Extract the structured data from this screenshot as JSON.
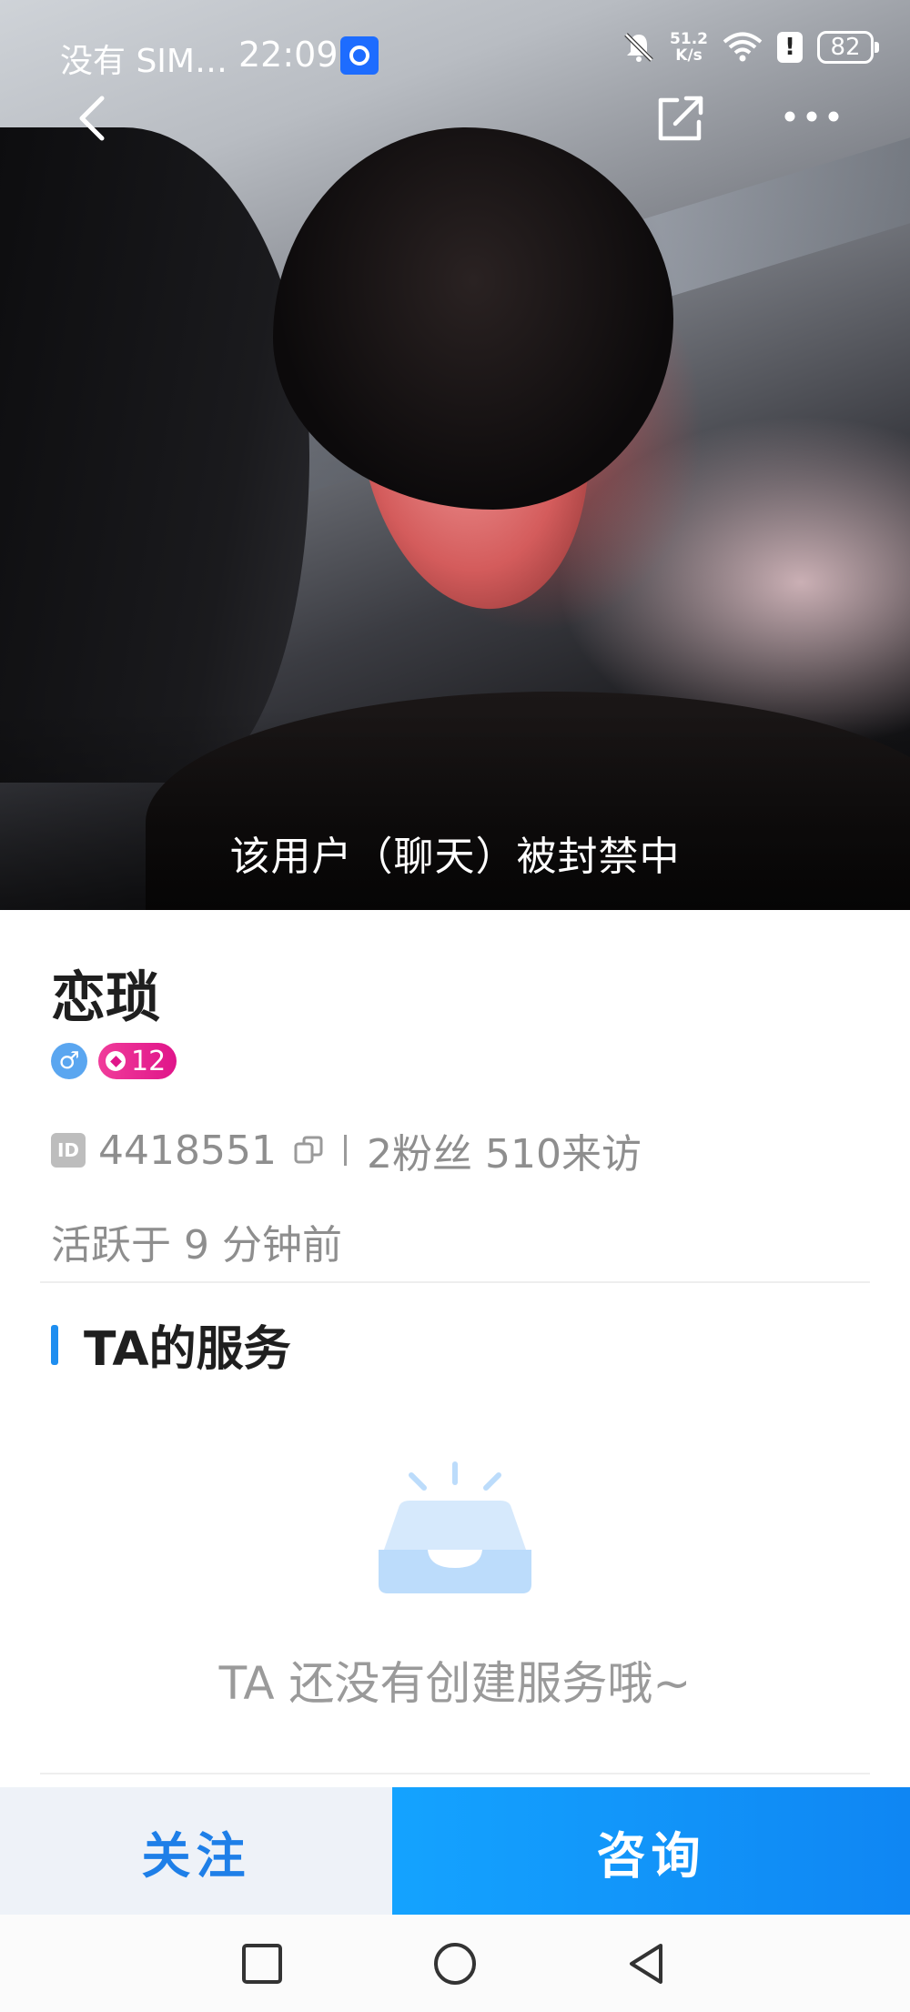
{
  "status_bar": {
    "carrier": "没有 SIM…",
    "time": "22:09",
    "net_speed_value": "51.2",
    "net_speed_unit": "K/s",
    "battery": "82"
  },
  "hero": {
    "banned_notice": "该用户（聊天）被封禁中"
  },
  "profile": {
    "name": "恋琐",
    "gender_symbol": "♂",
    "level": "12",
    "id_label": "ID",
    "id_value": "4418551",
    "fans": "2粉丝",
    "visits": "510来访",
    "active_status": "活跃于 9 分钟前"
  },
  "services": {
    "title": "TA的服务",
    "empty_text": "TA 还没有创建服务哦~"
  },
  "actions": {
    "follow_label": "关注",
    "consult_label": "咨询"
  },
  "colors": {
    "accent_blue": "#1e8ef0",
    "consult_gradient_start": "#14a3ff",
    "level_pink": "#e0158a"
  }
}
